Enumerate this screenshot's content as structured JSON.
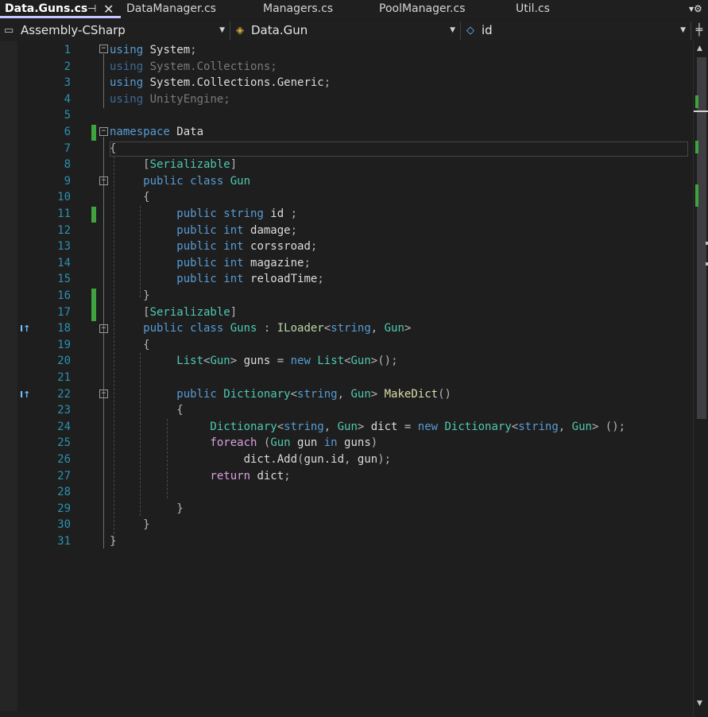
{
  "tabs": [
    {
      "label": "Data.Guns.cs",
      "active": true
    },
    {
      "label": "DataManager.cs"
    },
    {
      "label": "Managers.cs"
    },
    {
      "label": "PoolManager.cs"
    },
    {
      "label": "Util.cs"
    }
  ],
  "tab_pin_icon": "⊣",
  "tab_close_icon": "✕",
  "navbar": {
    "project": "Assembly-CSharp",
    "type": "Data.Gun",
    "member": "id"
  },
  "code_lines": [
    {
      "n": "1"
    },
    {
      "n": "2"
    },
    {
      "n": "3"
    },
    {
      "n": "4"
    },
    {
      "n": "5"
    },
    {
      "n": "6"
    },
    {
      "n": "7"
    },
    {
      "n": "8"
    },
    {
      "n": "9"
    },
    {
      "n": "10"
    },
    {
      "n": "11"
    },
    {
      "n": "12"
    },
    {
      "n": "13"
    },
    {
      "n": "14"
    },
    {
      "n": "15"
    },
    {
      "n": "16"
    },
    {
      "n": "17"
    },
    {
      "n": "18"
    },
    {
      "n": "19"
    },
    {
      "n": "20"
    },
    {
      "n": "21"
    },
    {
      "n": "22"
    },
    {
      "n": "23"
    },
    {
      "n": "24"
    },
    {
      "n": "25"
    },
    {
      "n": "26"
    },
    {
      "n": "27"
    },
    {
      "n": "28"
    },
    {
      "n": "29"
    },
    {
      "n": "30"
    },
    {
      "n": "31"
    }
  ],
  "code": {
    "l1": [
      [
        "kw",
        "using"
      ],
      [
        "ns",
        " System"
      ],
      [
        "punct",
        ";"
      ]
    ],
    "l2": [
      [
        "kwd",
        "using"
      ],
      [
        "dim",
        " System.Collections;"
      ]
    ],
    "l3": [
      [
        "kw",
        "using"
      ],
      [
        "ns",
        " System.Collections.Generic"
      ],
      [
        "punct",
        ";"
      ]
    ],
    "l4": [
      [
        "kwd",
        "using"
      ],
      [
        "dim",
        " UnityEngine;"
      ]
    ],
    "l5": [],
    "l6": [
      [
        "kw",
        "namespace"
      ],
      [
        "ns",
        " Data"
      ]
    ],
    "l7": [
      [
        "punct",
        "{"
      ]
    ],
    "l8": [
      [
        "punct",
        "     ["
      ],
      [
        "attr",
        "Serializable"
      ],
      [
        "punct",
        "]"
      ]
    ],
    "l9": [
      [
        "kw",
        "     public class "
      ],
      [
        "ty",
        "Gun"
      ]
    ],
    "l10": [
      [
        "punct",
        "     {"
      ]
    ],
    "l11": [
      [
        "kw",
        "          public string "
      ],
      [
        "ns",
        "id "
      ],
      [
        "punct",
        ";"
      ]
    ],
    "l12": [
      [
        "kw",
        "          public int "
      ],
      [
        "ns",
        "damage"
      ],
      [
        "punct",
        ";"
      ]
    ],
    "l13": [
      [
        "kw",
        "          public int "
      ],
      [
        "ns",
        "corssroad"
      ],
      [
        "punct",
        ";"
      ]
    ],
    "l14": [
      [
        "kw",
        "          public int "
      ],
      [
        "ns",
        "magazine"
      ],
      [
        "punct",
        ";"
      ]
    ],
    "l15": [
      [
        "kw",
        "          public int "
      ],
      [
        "ns",
        "reloadTime"
      ],
      [
        "punct",
        ";"
      ]
    ],
    "l16": [
      [
        "punct",
        "     }"
      ]
    ],
    "l17": [
      [
        "punct",
        "     ["
      ],
      [
        "attr",
        "Serializable"
      ],
      [
        "punct",
        "]"
      ]
    ],
    "l18": [
      [
        "kw",
        "     public class "
      ],
      [
        "ty",
        "Guns"
      ],
      [
        "punct",
        " : "
      ],
      [
        "iface",
        "ILoader"
      ],
      [
        "punct",
        "<"
      ],
      [
        "kw",
        "string"
      ],
      [
        "punct",
        ", "
      ],
      [
        "ty",
        "Gun"
      ],
      [
        "punct",
        ">"
      ]
    ],
    "l19": [
      [
        "punct",
        "     {"
      ]
    ],
    "l20": [
      [
        "ty",
        "          List"
      ],
      [
        "punct",
        "<"
      ],
      [
        "ty",
        "Gun"
      ],
      [
        "punct",
        "> "
      ],
      [
        "ns",
        "guns "
      ],
      [
        "punct",
        "= "
      ],
      [
        "kw",
        "new "
      ],
      [
        "ty",
        "List"
      ],
      [
        "punct",
        "<"
      ],
      [
        "ty",
        "Gun"
      ],
      [
        "punct",
        ">();"
      ]
    ],
    "l21": [],
    "l22": [
      [
        "kw",
        "          public "
      ],
      [
        "ty",
        "Dictionary"
      ],
      [
        "punct",
        "<"
      ],
      [
        "kw",
        "string"
      ],
      [
        "punct",
        ", "
      ],
      [
        "ty",
        "Gun"
      ],
      [
        "punct",
        "> "
      ],
      [
        "meth",
        "MakeDict"
      ],
      [
        "punct",
        "()"
      ]
    ],
    "l23": [
      [
        "punct",
        "          {"
      ]
    ],
    "l24": [
      [
        "ty",
        "               Dictionary"
      ],
      [
        "punct",
        "<"
      ],
      [
        "kw",
        "string"
      ],
      [
        "punct",
        ", "
      ],
      [
        "ty",
        "Gun"
      ],
      [
        "punct",
        "> "
      ],
      [
        "ns",
        "dict "
      ],
      [
        "punct",
        "= "
      ],
      [
        "kw",
        "new "
      ],
      [
        "ty",
        "Dictionary"
      ],
      [
        "punct",
        "<"
      ],
      [
        "kw",
        "string"
      ],
      [
        "punct",
        ", "
      ],
      [
        "ty",
        "Gun"
      ],
      [
        "punct",
        "> ();"
      ]
    ],
    "l25": [
      [
        "ctrl",
        "               foreach "
      ],
      [
        "punct",
        "("
      ],
      [
        "ty",
        "Gun "
      ],
      [
        "ns",
        "gun "
      ],
      [
        "kw",
        "in "
      ],
      [
        "ns",
        "guns"
      ],
      [
        "punct",
        ")"
      ]
    ],
    "l26": [
      [
        "ns",
        "                    dict.Add"
      ],
      [
        "punct",
        "("
      ],
      [
        "ns",
        "gun.id"
      ],
      [
        "punct",
        ", "
      ],
      [
        "ns",
        "gun"
      ],
      [
        "punct",
        ");"
      ]
    ],
    "l27": [
      [
        "ctrl",
        "               return "
      ],
      [
        "ns",
        "dict"
      ],
      [
        "punct",
        ";"
      ]
    ],
    "l28": [],
    "l29": [
      [
        "punct",
        "          }"
      ]
    ],
    "l30": [
      [
        "punct",
        "     }"
      ]
    ],
    "l31": [
      [
        "punct",
        "}"
      ]
    ]
  },
  "codelens_icon": "I↑",
  "colors": {
    "keyword": "#569cd6",
    "type": "#4ec9b0",
    "line_number": "#2b91af",
    "change_marker": "#3fa33f"
  }
}
